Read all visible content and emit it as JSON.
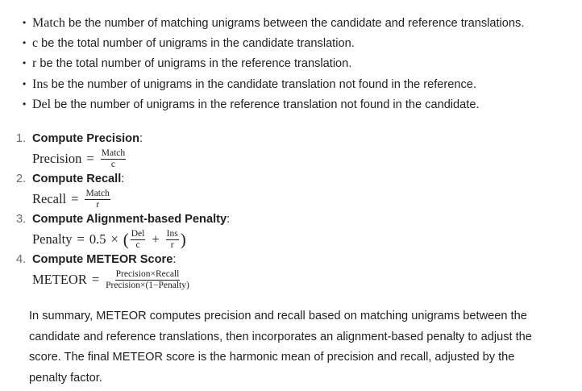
{
  "definitions": [
    {
      "symbol": "Match",
      "text": "be the number of matching unigrams between the candidate and reference translations."
    },
    {
      "symbol": "c",
      "text": "be the total number of unigrams in the candidate translation."
    },
    {
      "symbol": "r",
      "text": "be the total number of unigrams in the reference translation."
    },
    {
      "symbol": "Ins",
      "text": "be the number of unigrams in the candidate translation not found in the reference."
    },
    {
      "symbol": "Del",
      "text": "be the number of unigrams in the reference translation not found in the candidate."
    }
  ],
  "steps": [
    {
      "number": "1.",
      "title": "Compute Precision",
      "colon": ":",
      "formula": {
        "lhs": "Precision",
        "eq": "=",
        "num": "Match",
        "den": "c"
      }
    },
    {
      "number": "2.",
      "title": "Compute Recall",
      "colon": ":",
      "formula": {
        "lhs": "Recall",
        "eq": "=",
        "num": "Match",
        "den": "r"
      }
    },
    {
      "number": "3.",
      "title": "Compute Alignment-based Penalty",
      "colon": ":",
      "formula": {
        "lhs": "Penalty",
        "eq": "=",
        "coef": "0.5",
        "times": "×",
        "open": "(",
        "num1": "Del",
        "den1": "c",
        "plus": "+",
        "num2": "Ins",
        "den2": "r",
        "close": ")"
      }
    },
    {
      "number": "4.",
      "title": "Compute METEOR Score",
      "colon": ":",
      "formula": {
        "lhs": "METEOR",
        "eq": "=",
        "num": "Precision×Recall",
        "den": "Precision×(1−Penalty)"
      }
    }
  ],
  "summary": "In summary, METEOR computes precision and recall based on matching unigrams between the candidate and reference translations, then incorporates an alignment-based penalty to adjust the score. The final METEOR score is the harmonic mean of precision and recall, adjusted by the penalty factor."
}
